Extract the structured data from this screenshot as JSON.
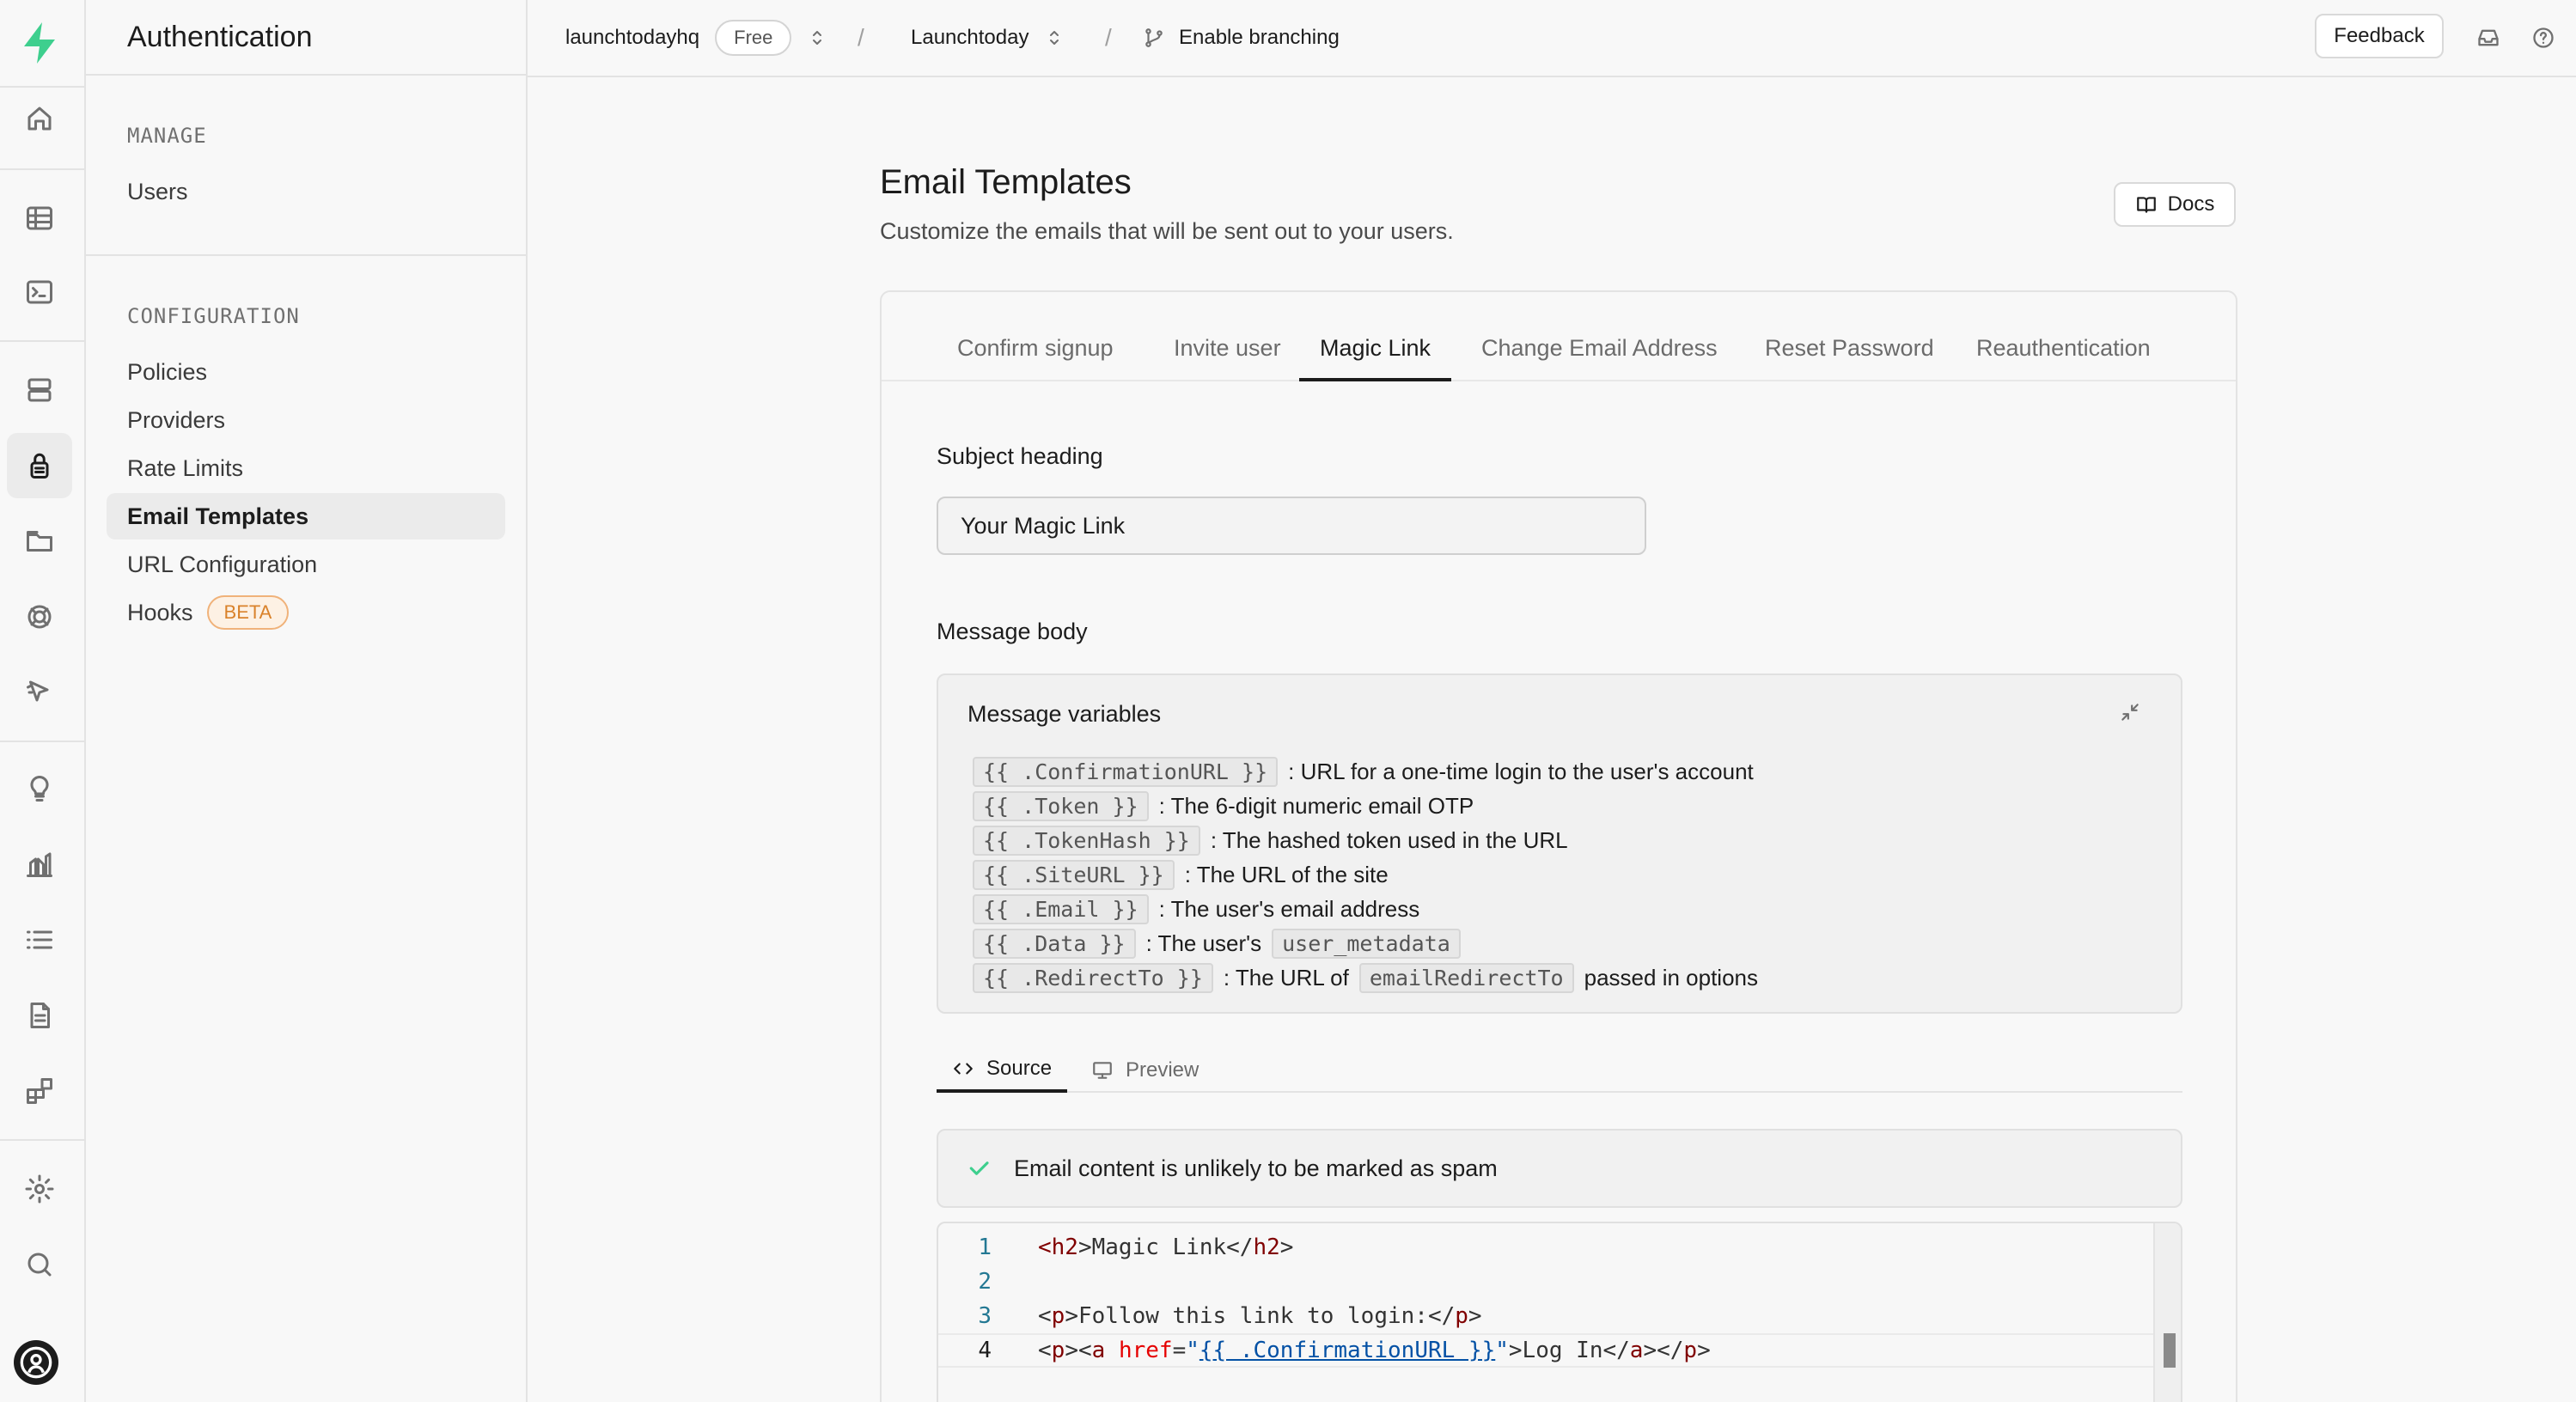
{
  "nav": {
    "section_title": "Authentication",
    "groups": [
      {
        "title": "MANAGE",
        "items": [
          {
            "label": "Users"
          }
        ]
      },
      {
        "title": "CONFIGURATION",
        "items": [
          {
            "label": "Policies"
          },
          {
            "label": "Providers"
          },
          {
            "label": "Rate Limits"
          },
          {
            "label": "Email Templates"
          },
          {
            "label": "URL Configuration"
          },
          {
            "label": "Hooks",
            "badge": "BETA"
          }
        ]
      }
    ],
    "active_item": "Email Templates"
  },
  "topbar": {
    "org": "launchtodayhq",
    "plan": "Free",
    "project": "Launchtoday",
    "branching": "Enable branching",
    "feedback": "Feedback"
  },
  "page": {
    "title": "Email Templates",
    "subtitle": "Customize the emails that will be sent out to your users.",
    "docs_label": "Docs"
  },
  "template_tabs": [
    "Confirm signup",
    "Invite user",
    "Magic Link",
    "Change Email Address",
    "Reset Password",
    "Reauthentication"
  ],
  "active_tab": "Magic Link",
  "form": {
    "subject_label": "Subject heading",
    "subject_value": "Your Magic Link",
    "body_label": "Message body"
  },
  "variables": {
    "title": "Message variables",
    "rows": [
      {
        "var": "{{ .ConfirmationURL }}",
        "desc": ": URL for a one-time login to the user's account"
      },
      {
        "var": "{{ .Token }}",
        "desc": ": The 6-digit numeric email OTP"
      },
      {
        "var": "{{ .TokenHash }}",
        "desc": ": The hashed token used in the URL"
      },
      {
        "var": "{{ .SiteURL }}",
        "desc": ": The URL of the site"
      },
      {
        "var": "{{ .Email }}",
        "desc": ": The user's email address"
      },
      {
        "var": "{{ .Data }}",
        "desc": ": The user's",
        "chip": "user_metadata"
      },
      {
        "var": "{{ .RedirectTo }}",
        "desc": ": The URL of",
        "chip": "emailRedirectTo",
        "tail": "passed in options"
      }
    ]
  },
  "source_tabs": [
    "Source",
    "Preview"
  ],
  "active_source_tab": "Source",
  "spam_status": "Email content is unlikely to be marked as spam",
  "editor": {
    "lines": [
      {
        "n": "1",
        "text": "<h2>Magic Link</h2>"
      },
      {
        "n": "2",
        "text": ""
      },
      {
        "n": "3",
        "text": "<p>Follow this link to login:</p>"
      },
      {
        "n": "4",
        "text": "<p><a href=\"{{ .ConfirmationURL }}\">Log In</a></p>"
      }
    ]
  },
  "colors": {
    "brand": "#3ecf8e",
    "beta": "#d9822b",
    "check": "#3ecf8e"
  }
}
